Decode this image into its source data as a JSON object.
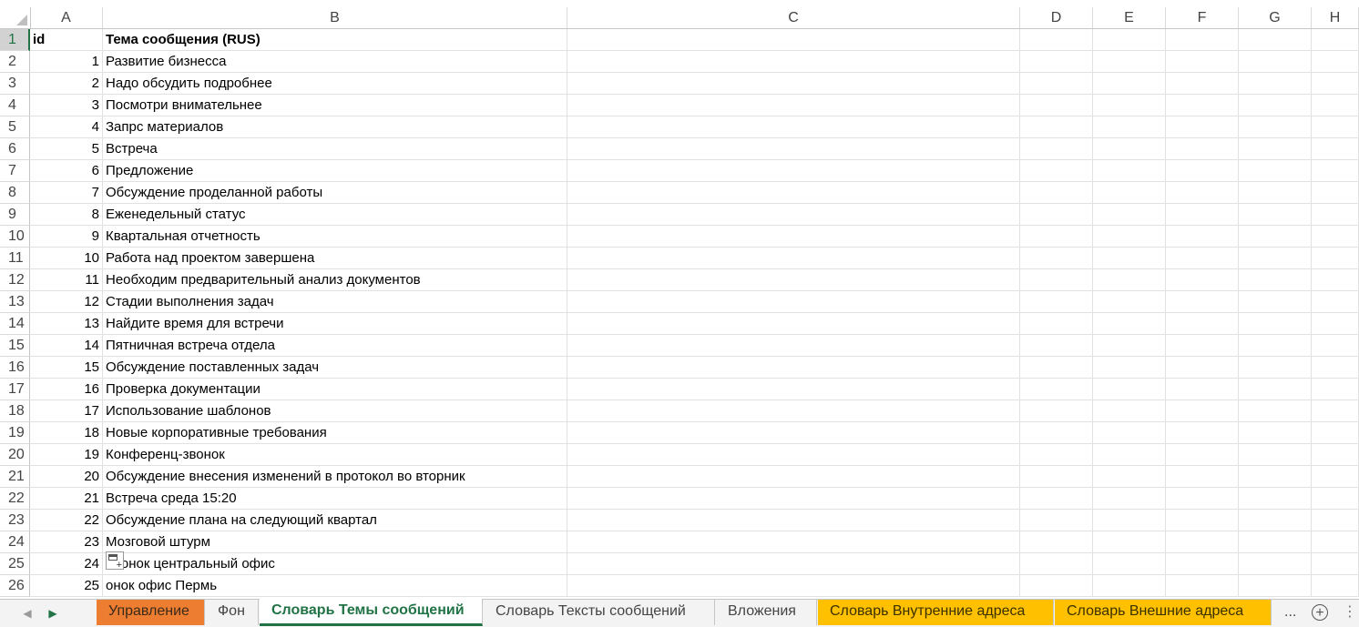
{
  "columns": [
    "A",
    "B",
    "C",
    "D",
    "E",
    "F",
    "G",
    "H"
  ],
  "rows": [
    {
      "n": "1",
      "id": "id",
      "subject": "Тема сообщения (RUS)",
      "header": true
    },
    {
      "n": "2",
      "id": "1",
      "subject": "Развитие бизнесса"
    },
    {
      "n": "3",
      "id": "2",
      "subject": "Надо обсудить подробнее"
    },
    {
      "n": "4",
      "id": "3",
      "subject": "Посмотри внимательнее"
    },
    {
      "n": "5",
      "id": "4",
      "subject": "Запрс материалов"
    },
    {
      "n": "6",
      "id": "5",
      "subject": "Встреча"
    },
    {
      "n": "7",
      "id": "6",
      "subject": "Предложение"
    },
    {
      "n": "8",
      "id": "7",
      "subject": "Обсуждение проделанной работы"
    },
    {
      "n": "9",
      "id": "8",
      "subject": "Еженедельный статус"
    },
    {
      "n": "10",
      "id": "9",
      "subject": "Квартальная отчетность"
    },
    {
      "n": "11",
      "id": "10",
      "subject": "Работа над проектом завершена"
    },
    {
      "n": "12",
      "id": "11",
      "subject": "Необходим предварительный анализ документов"
    },
    {
      "n": "13",
      "id": "12",
      "subject": "Стадии выполнения задач"
    },
    {
      "n": "14",
      "id": "13",
      "subject": "Найдите время для встречи"
    },
    {
      "n": "15",
      "id": "14",
      "subject": "Пятничная встреча отдела"
    },
    {
      "n": "16",
      "id": "15",
      "subject": "Обсуждение поставленных задач"
    },
    {
      "n": "17",
      "id": "16",
      "subject": "Проверка документации"
    },
    {
      "n": "18",
      "id": "17",
      "subject": "Использование шаблонов"
    },
    {
      "n": "19",
      "id": "18",
      "subject": "Новые корпоративные требования"
    },
    {
      "n": "20",
      "id": "19",
      "subject": "Конференц-звонок"
    },
    {
      "n": "21",
      "id": "20",
      "subject": "Обсуждение внесения изменений в протокол во вторник"
    },
    {
      "n": "22",
      "id": "21",
      "subject": "Встреча среда 15:20"
    },
    {
      "n": "23",
      "id": "22",
      "subject": "Обсуждение плана на следующий квартал"
    },
    {
      "n": "24",
      "id": "23",
      "subject": "Мозговой штурм"
    },
    {
      "n": "25",
      "id": "24",
      "subject": "Звонок центральный офис"
    },
    {
      "n": "26",
      "id": "25",
      "subject": "онок офис Пермь"
    }
  ],
  "selected_row": "1",
  "sheet_tabs": [
    {
      "label": "Управление",
      "color": "#ed7d31"
    },
    {
      "label": "Фон"
    },
    {
      "label": "Словарь Темы сообщений",
      "active": true
    },
    {
      "label": "Словарь Тексты сообщений"
    },
    {
      "label": "Вложения"
    },
    {
      "label": "Словарь Внутренние адреса",
      "color": "#ffc000"
    },
    {
      "label": "Словарь Внешние адреса",
      "color": "#ffc000"
    }
  ],
  "tab_more": "...",
  "nav_prev_icon": "triangle-left-icon",
  "nav_next_icon": "triangle-right-icon",
  "add_sheet_icon": "plus-circle-icon",
  "accent_color": "#217346"
}
